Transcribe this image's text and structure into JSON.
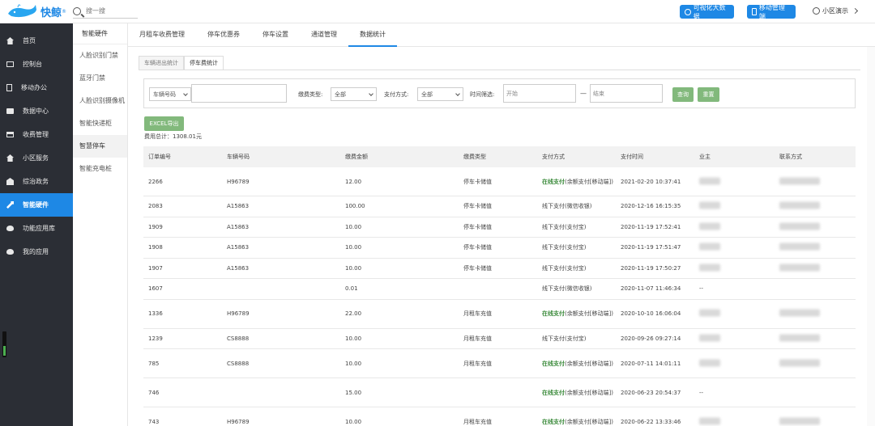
{
  "header": {
    "logo_text": "快鲸",
    "logo_reg": "®",
    "search_placeholder": "搜一搜",
    "btn_bigdata": "可视化大数据",
    "btn_mobile": "移动管理端",
    "user_label": "小区演示"
  },
  "sidebar": {
    "items": [
      {
        "label": "首页",
        "icon": "home-icon"
      },
      {
        "label": "控制台",
        "icon": "monitor-icon"
      },
      {
        "label": "移动办公",
        "icon": "phone-icon"
      },
      {
        "label": "数据中心",
        "icon": "briefcase-icon"
      },
      {
        "label": "收费管理",
        "icon": "card-icon"
      },
      {
        "label": "小区服务",
        "icon": "home-icon"
      },
      {
        "label": "综治政务",
        "icon": "bank-icon"
      },
      {
        "label": "智能硬件",
        "icon": "wrench-icon"
      },
      {
        "label": "功能应用库",
        "icon": "cloud-icon"
      },
      {
        "label": "我的应用",
        "icon": "cloud-icon"
      }
    ]
  },
  "submenu": {
    "title": "智能硬件",
    "items": [
      "人脸识别门禁",
      "蓝牙门禁",
      "人脸识别摄像机",
      "智能快递柜",
      "智慧停车",
      "智能充电桩"
    ]
  },
  "navtabs": [
    "月租车收费管理",
    "停车优惠券",
    "停车设置",
    "通道管理",
    "数据统计"
  ],
  "subtabs": [
    "车辆进出统计",
    "停车费统计"
  ],
  "filter": {
    "plate_select": "车辆号码",
    "fee_type_label": "缴费类型:",
    "fee_type_value": "全部",
    "pay_method_label": "支付方式:",
    "pay_method_value": "全部",
    "time_label": "时间筛选:",
    "start_placeholder": "开始",
    "end_placeholder": "结束",
    "dash": "—",
    "query_btn": "查询",
    "reset_btn": "重置"
  },
  "excel_btn": "EXCEL导出",
  "total": "费用总计：1308.01元",
  "table": {
    "headers": [
      "订单编号",
      "车辆号码",
      "缴费金额",
      "缴费类型",
      "支付方式",
      "支付时间",
      "业主",
      "联系方式"
    ],
    "rows": [
      {
        "id": "2266",
        "plate": "H96789",
        "amount": "12.00",
        "type": "停车卡储值",
        "pay_online": "在线支付",
        "pay_rest": "(余额支付[移动端])",
        "time": "2021-02-20 10:37:41",
        "owner": "",
        "phone": "",
        "tall": true
      },
      {
        "id": "2083",
        "plate": "A15863",
        "amount": "100.00",
        "type": "停车卡储值",
        "pay_online": "",
        "pay_rest": "线下支付(微信收银)",
        "time": "2020-12-16 16:15:35",
        "owner": "",
        "phone": "",
        "tall": false
      },
      {
        "id": "1909",
        "plate": "A15863",
        "amount": "10.00",
        "type": "停车卡储值",
        "pay_online": "",
        "pay_rest": "线下支付(支付宝)",
        "time": "2020-11-19 17:52:41",
        "owner": "",
        "phone": "",
        "tall": false
      },
      {
        "id": "1908",
        "plate": "A15863",
        "amount": "10.00",
        "type": "停车卡储值",
        "pay_online": "",
        "pay_rest": "线下支付(支付宝)",
        "time": "2020-11-19 17:51:47",
        "owner": "",
        "phone": "",
        "tall": false
      },
      {
        "id": "1907",
        "plate": "A15863",
        "amount": "10.00",
        "type": "停车卡储值",
        "pay_online": "",
        "pay_rest": "线下支付(支付宝)",
        "time": "2020-11-19 17:50:27",
        "owner": "",
        "phone": "",
        "tall": false
      },
      {
        "id": "1607",
        "plate": "",
        "amount": "0.01",
        "type": "",
        "pay_online": "",
        "pay_rest": "线下支付(微信收银)",
        "time": "2020-11-07 11:46:34",
        "owner": "--",
        "phone": "",
        "tall": false
      },
      {
        "id": "1336",
        "plate": "H96789",
        "amount": "22.00",
        "type": "月租车充值",
        "pay_online": "在线支付",
        "pay_rest": "(余额支付[移动端])",
        "time": "2020-10-10 16:06:04",
        "owner": "",
        "phone": "",
        "tall": true
      },
      {
        "id": "1239",
        "plate": "CS8888",
        "amount": "10.00",
        "type": "月租车充值",
        "pay_online": "",
        "pay_rest": "线下支付(支付宝)",
        "time": "2020-09-26 09:27:14",
        "owner": "",
        "phone": "",
        "tall": false
      },
      {
        "id": "785",
        "plate": "CS8888",
        "amount": "10.00",
        "type": "月租车充值",
        "pay_online": "在线支付",
        "pay_rest": "(余额支付[移动端])",
        "time": "2020-07-11 14:01:11",
        "owner": "",
        "phone": "",
        "tall": true
      },
      {
        "id": "746",
        "plate": "",
        "amount": "15.00",
        "type": "",
        "pay_online": "在线支付",
        "pay_rest": "(余额支付[移动端])",
        "time": "2020-06-23 20:54:37",
        "owner": "--",
        "phone": "",
        "tall": true
      },
      {
        "id": "743",
        "plate": "H96789",
        "amount": "10.00",
        "type": "月租车充值",
        "pay_online": "在线支付",
        "pay_rest": "(余额支付[移动端])",
        "time": "2020-06-22 13:33:46",
        "owner": "",
        "phone": "",
        "tall": true
      }
    ]
  }
}
